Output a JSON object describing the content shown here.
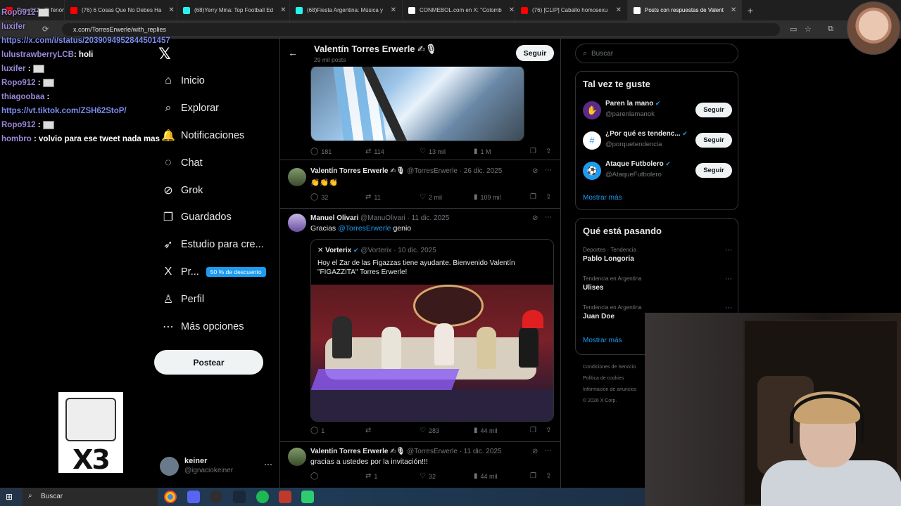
{
  "browser": {
    "tabs": [
      {
        "label": "Ropo912 : El fenómeno viral",
        "color": "#ff0000"
      },
      {
        "label": "(76) 6 Cosas Que No Debes Ha",
        "color": "#ff0000"
      },
      {
        "label": "(68)Yerry Mina: Top Football Ed",
        "color": "#25f4ee"
      },
      {
        "label": "(68)Fiesta Argentina: Música y",
        "color": "#25f4ee"
      },
      {
        "label": "CONMEBOL.com en X: \"Colomb",
        "color": "#ffffff"
      },
      {
        "label": "(76) [CLIP] Caballo homosexu",
        "color": "#ff0000"
      },
      {
        "label": "Posts con respuestas de Valent",
        "color": "#ffffff",
        "active": true
      }
    ],
    "new_tab": "+",
    "address": "x.com/TorresErwerle/with_replies"
  },
  "chat": [
    {
      "user": "Ropo912",
      "msg": "",
      "emote": true
    },
    {
      "user": "luxifer",
      "msg": "",
      "emote": false
    },
    {
      "user": "",
      "msg": "",
      "link": "https://x.com/i/status/2039094952844501457"
    },
    {
      "user": "lulustrawberryLCB",
      "msg": ": holi"
    },
    {
      "user": "luxifer",
      "msg": " :",
      "emote": true
    },
    {
      "user": "Ropo912",
      "msg": " :",
      "emote": true
    },
    {
      "user": "thiagoobaa",
      "msg": " :"
    },
    {
      "user": "",
      "msg": "",
      "link": "https://vt.tiktok.com/ZSH62StoP/"
    },
    {
      "user": "Ropo912",
      "msg": " :",
      "emote": true
    },
    {
      "user": "hombro",
      "msg": " : volvio para ese tweet nada mas"
    }
  ],
  "chat_emote_text": "X3",
  "nav": {
    "items": [
      {
        "label": "Inicio",
        "icon": "⌂"
      },
      {
        "label": "Explorar",
        "icon": "⌕"
      },
      {
        "label": "Notificaciones",
        "icon": "🔔"
      },
      {
        "label": "Chat",
        "icon": "◌"
      },
      {
        "label": "Grok",
        "icon": "⊘"
      },
      {
        "label": "Guardados",
        "icon": "❐"
      },
      {
        "label": "Estudio para cre...",
        "icon": "➶"
      },
      {
        "label": "Pr...",
        "icon": "X"
      },
      {
        "label": "Perfil",
        "icon": "♙"
      },
      {
        "label": "Más opciones",
        "icon": "⋯"
      }
    ],
    "premium_badge": "50 % de descuento",
    "post_button": "Postear",
    "account_name": "keiner",
    "account_handle": "@ignaciokeiner"
  },
  "profile": {
    "name": "Valentín Torres Erwerle ✍🎙",
    "posts": "29 mil posts",
    "follow": "Seguir"
  },
  "tweets": [
    {
      "stats": {
        "replies": "181",
        "reposts": "114",
        "likes": "13 mil",
        "views": "1 M"
      }
    },
    {
      "name": "Valentín Torres Erwerle ✍🎙",
      "handle": "@TorresErwerle",
      "date": "· 26 dic. 2025",
      "text": "👏👏👏",
      "stats": {
        "replies": "32",
        "reposts": "11",
        "likes": "2 mil",
        "views": "109 mil"
      }
    },
    {
      "name": "Manuel Olivari",
      "handle": "@ManuOlivari",
      "date": "· 11 dic. 2025",
      "text_before": "Gracias ",
      "mention": "@TorresErwerle",
      "text_after": " genio",
      "quote": {
        "name": "Vorterix",
        "handle": "@Vorterix",
        "date": "· 10 dic. 2025",
        "text": "Hoy el Zar de las Figazzas tiene ayudante. Bienvenido Valentín \"FIGAZZITA\" Torres Erwerle!"
      },
      "stats": {
        "replies": "1",
        "reposts": "",
        "likes": "283",
        "views": "44 mil"
      }
    },
    {
      "name": "Valentín Torres Erwerle ✍🎙",
      "handle": "@TorresErwerle",
      "date": "· 11 dic. 2025",
      "text": "gracias a ustedes por la invitación!!!",
      "stats": {
        "replies": "",
        "reposts": "1",
        "likes": "32",
        "views": "44 mil"
      }
    }
  ],
  "right": {
    "search_placeholder": "Buscar",
    "suggest_title": "Tal vez te guste",
    "suggestions": [
      {
        "name": "Paren la mano",
        "handle": "@parenlamanok",
        "button": "Seguir",
        "color": "#5b2a86",
        "glyph": "✋"
      },
      {
        "name": "¿Por qué es tendenc...",
        "handle": "@porquetendencia",
        "button": "Seguir",
        "color": "#ffffff",
        "glyph": "#"
      },
      {
        "name": "Ataque Futbolero",
        "handle": "@AtaqueFutbolero",
        "button": "Seguir",
        "color": "#1d9bf0",
        "glyph": "⚽"
      }
    ],
    "show_more": "Mostrar más",
    "trends_title": "Qué está pasando",
    "trends": [
      {
        "category": "Deportes · Tendencia",
        "name": "Pablo Longoria"
      },
      {
        "category": "Tendencia en Argentina",
        "name": "Ulises"
      },
      {
        "category": "Tendencia en Argentina",
        "name": "Juan Doe"
      }
    ],
    "trends_more": "Mostrar más",
    "footer": [
      "Condiciones de Servicio",
      "Política de cookies",
      "Información de anuncios",
      "© 2026 X Corp."
    ]
  },
  "taskbar": {
    "search_label": "Buscar"
  }
}
